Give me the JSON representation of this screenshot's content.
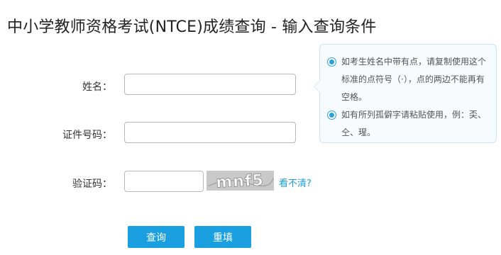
{
  "page": {
    "title": "中小学教师资格考试(NTCE)成绩查询 - 输入查询条件"
  },
  "form": {
    "name_label": "姓名：",
    "name_value": "",
    "id_label": "证件号码：",
    "id_value": "",
    "captcha_label": "验证码：",
    "captcha_value": "",
    "captcha_text": "mnf5",
    "refresh_label": "看不清?"
  },
  "buttons": {
    "query_label": "查询",
    "reset_label": "重填"
  },
  "tips": [
    {
      "text": "如考生姓名中带有点，请复制使用这个标准的点符号（·），点的两边不能再有空格。"
    },
    {
      "text": "如有所列孤僻字请粘贴使用，例：奀、仝、瑆。"
    }
  ],
  "colors": {
    "accent": "#1aa0e0",
    "link": "#1a9ed8",
    "tip_border": "#cde3ef",
    "tip_background": "#f7fbfd"
  },
  "icons": {
    "tip_bullet": "radio-dot-icon"
  }
}
